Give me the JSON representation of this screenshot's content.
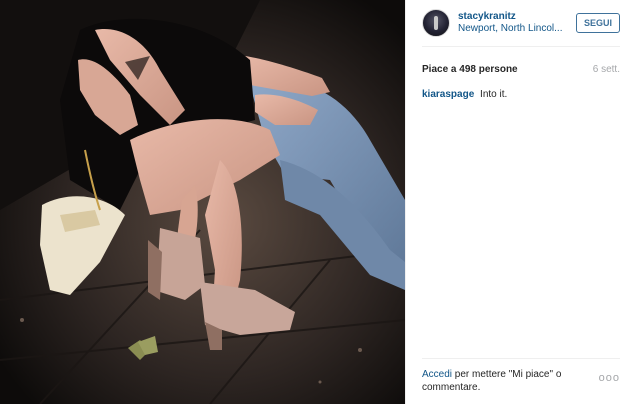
{
  "post": {
    "user": {
      "username": "stacykranitz",
      "location": "Newport, North Lincol..."
    },
    "follow_label": "SEGUI",
    "likes_text": "Piace a 498 persone",
    "time_ago": "6 sett.",
    "comments": [
      {
        "username": "kiaraspage",
        "text": "Into it."
      }
    ],
    "footer": {
      "login_link": "Accedi",
      "text": " per mettere \"Mi piace\" o commentare.",
      "more_label": "ooo"
    }
  },
  "colors": {
    "link_blue": "#125688",
    "follow_border": "#3f729b",
    "muted_gray": "#a5a7aa",
    "separator": "#efefef"
  },
  "icons": {
    "avatar": "profile-avatar",
    "more": "more-options-icon"
  }
}
